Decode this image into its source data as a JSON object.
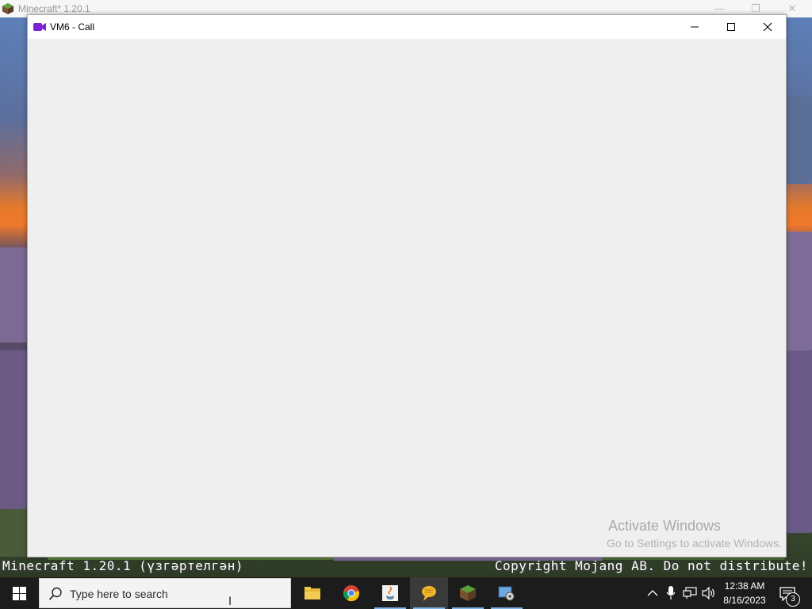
{
  "minecraft": {
    "window_title": "Minecraft* 1.20.1",
    "footer_version": "Minecraft 1.20.1 (үзгәртелгән)",
    "footer_copyright": "Copyright Mojang AB. Do not distribute!"
  },
  "call_window": {
    "title": "VM6 - Call",
    "icon": "video-camera-icon",
    "accent": "#7b22d4",
    "minimize": "minimize-icon",
    "maximize": "maximize-icon",
    "close": "close-icon"
  },
  "watermark": {
    "title": "Activate Windows",
    "subtitle": "Go to Settings to activate Windows."
  },
  "taskbar": {
    "search_placeholder": "Type here to search",
    "apps": [
      {
        "name": "file-explorer-icon"
      },
      {
        "name": "chrome-icon"
      },
      {
        "name": "java-icon"
      },
      {
        "name": "chat-bubble-icon"
      },
      {
        "name": "minecraft-grass-block-icon"
      },
      {
        "name": "vm-settings-icon"
      }
    ],
    "clock_time": "12:38 AM",
    "clock_date": "8/16/2023",
    "notification_count": "3"
  }
}
